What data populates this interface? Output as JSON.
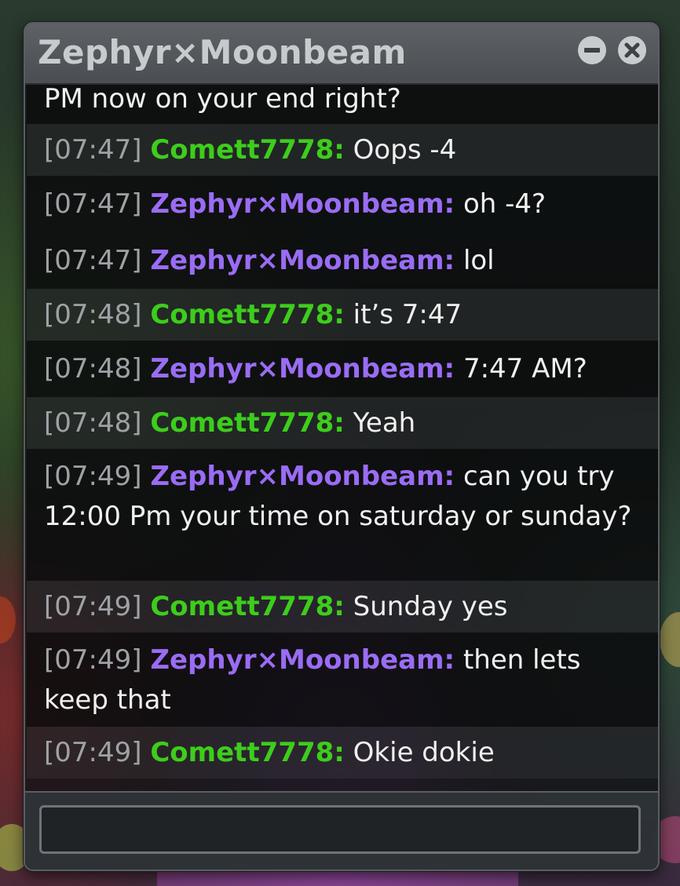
{
  "window": {
    "title": "Zephyr⨯Moonbeam"
  },
  "messages": [
    {
      "continuation": true,
      "text": "PM now on your end right?"
    },
    {
      "timestamp": "[07:47]",
      "sender": "Comett7778:",
      "text": "Oops -4"
    },
    {
      "timestamp": "[07:47]",
      "sender": "Zephyr⨯Moonbeam:",
      "text": "oh -4?"
    },
    {
      "timestamp": "[07:47]",
      "sender": "Zephyr⨯Moonbeam:",
      "text": "lol"
    },
    {
      "timestamp": "[07:48]",
      "sender": "Comett7778:",
      "text": "it’s 7:47"
    },
    {
      "timestamp": "[07:48]",
      "sender": "Zephyr⨯Moonbeam:",
      "text": "7:47 AM?"
    },
    {
      "timestamp": "[07:48]",
      "sender": "Comett7778:",
      "text": "Yeah"
    },
    {
      "timestamp": "[07:49]",
      "sender": "Zephyr⨯Moonbeam:",
      "text": "can you try 12:00 Pm your time on saturday or sunday?"
    },
    {
      "timestamp": "[07:49]",
      "sender": "Comett7778:",
      "text": "Sunday yes"
    },
    {
      "timestamp": "[07:49]",
      "sender": "Zephyr⨯Moonbeam:",
      "text": "then lets keep that"
    },
    {
      "timestamp": "[07:49]",
      "sender": "Comett7778:",
      "text": "Okie dokie"
    }
  ],
  "input": {
    "value": "",
    "placeholder": ""
  },
  "colors": {
    "comett_name": "#3dcd1c",
    "zephyr_name": "#9a6cf4",
    "timestamp": "#9ea2a6",
    "message_text": "#f0f0f0"
  },
  "icons": {
    "minimize": "minimize-icon",
    "close": "close-icon"
  }
}
